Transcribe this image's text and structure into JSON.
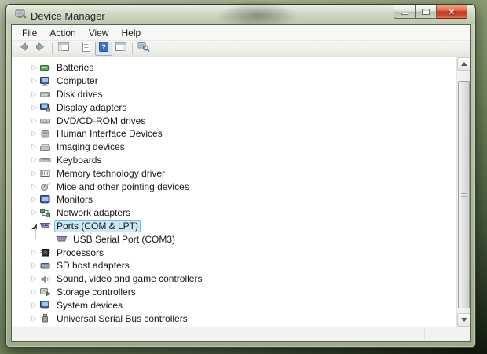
{
  "window": {
    "title": "Device Manager",
    "controls": [
      {
        "name": "minimize"
      },
      {
        "name": "maximize"
      },
      {
        "name": "close"
      }
    ]
  },
  "menu_bar": {
    "items": [
      {
        "label": "File"
      },
      {
        "label": "Action"
      },
      {
        "label": "View"
      },
      {
        "label": "Help"
      }
    ]
  },
  "toolbar": {
    "buttons": [
      {
        "name": "back",
        "icon": "back-arrow-icon"
      },
      {
        "name": "forward",
        "icon": "forward-arrow-icon"
      },
      {
        "name": "separator"
      },
      {
        "name": "show-console-tree",
        "icon": "console-tree-icon"
      },
      {
        "name": "separator"
      },
      {
        "name": "properties",
        "icon": "properties-icon"
      },
      {
        "name": "help",
        "icon": "help-icon",
        "pressed": true
      },
      {
        "name": "action-pane",
        "icon": "action-pane-icon"
      },
      {
        "name": "separator"
      },
      {
        "name": "scan-hardware-changes",
        "icon": "scan-hardware-icon"
      }
    ]
  },
  "tree": {
    "items": [
      {
        "label": "Batteries",
        "icon": "battery-icon",
        "state": "collapsed",
        "level": 0,
        "selected": false
      },
      {
        "label": "Computer",
        "icon": "computer-icon",
        "state": "collapsed",
        "level": 0,
        "selected": false
      },
      {
        "label": "Disk drives",
        "icon": "disk-drive-icon",
        "state": "collapsed",
        "level": 0,
        "selected": false
      },
      {
        "label": "Display adapters",
        "icon": "display-adapter-icon",
        "state": "collapsed",
        "level": 0,
        "selected": false
      },
      {
        "label": "DVD/CD-ROM drives",
        "icon": "dvd-drive-icon",
        "state": "collapsed",
        "level": 0,
        "selected": false
      },
      {
        "label": "Human Interface Devices",
        "icon": "hid-icon",
        "state": "collapsed",
        "level": 0,
        "selected": false
      },
      {
        "label": "Imaging devices",
        "icon": "imaging-device-icon",
        "state": "collapsed",
        "level": 0,
        "selected": false
      },
      {
        "label": "Keyboards",
        "icon": "keyboard-icon",
        "state": "collapsed",
        "level": 0,
        "selected": false
      },
      {
        "label": "Memory technology driver",
        "icon": "memory-card-icon",
        "state": "collapsed",
        "level": 0,
        "selected": false
      },
      {
        "label": "Mice and other pointing devices",
        "icon": "mouse-icon",
        "state": "collapsed",
        "level": 0,
        "selected": false
      },
      {
        "label": "Monitors",
        "icon": "monitor-icon",
        "state": "collapsed",
        "level": 0,
        "selected": false
      },
      {
        "label": "Network adapters",
        "icon": "network-adapter-icon",
        "state": "collapsed",
        "level": 0,
        "selected": false
      },
      {
        "label": "Ports (COM & LPT)",
        "icon": "serial-port-icon",
        "state": "expanded",
        "level": 0,
        "selected": true
      },
      {
        "label": "USB Serial Port (COM3)",
        "icon": "serial-port-icon",
        "state": "leaf",
        "level": 1,
        "selected": false
      },
      {
        "label": "Processors",
        "icon": "processor-icon",
        "state": "collapsed",
        "level": 0,
        "selected": false
      },
      {
        "label": "SD host adapters",
        "icon": "sd-host-icon",
        "state": "collapsed",
        "level": 0,
        "selected": false
      },
      {
        "label": "Sound, video and game controllers",
        "icon": "sound-icon",
        "state": "collapsed",
        "level": 0,
        "selected": false
      },
      {
        "label": "Storage controllers",
        "icon": "storage-controller-icon",
        "state": "collapsed",
        "level": 0,
        "selected": false
      },
      {
        "label": "System devices",
        "icon": "system-device-icon",
        "state": "collapsed",
        "level": 0,
        "selected": false
      },
      {
        "label": "Universal Serial Bus controllers",
        "icon": "usb-icon",
        "state": "collapsed",
        "level": 0,
        "selected": false
      }
    ]
  },
  "scrollbar": {
    "orientation": "vertical"
  },
  "colors": {
    "selection_fill": "#cbe8f6",
    "selection_border": "#70c0e7",
    "close_button": "#c03a22",
    "help_icon_blue": "#3f6fbf",
    "desktop_green": "#74885f"
  }
}
